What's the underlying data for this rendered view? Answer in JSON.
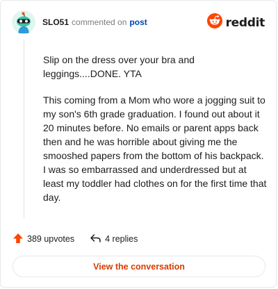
{
  "header": {
    "username": "SLO51",
    "commented_text": "commented on",
    "post_link": "post"
  },
  "brand": {
    "name": "reddit",
    "color": "#ff4500"
  },
  "comment": {
    "paragraphs": [
      "Slip on the dress over your bra and leggings....DONE. YTA",
      "This coming from a Mom who wore a jogging suit to my son's 6th grade graduation. I found out about it 20 minutes before. No emails or parent apps back then and he was horrible about giving me the smooshed papers from the bottom of his backpack. I was so embarrassed and underdressed but at least my toddler had clothes on for the first time that day."
    ]
  },
  "footer": {
    "upvotes": "389 upvotes",
    "replies": "4 replies",
    "upvote_icon": "upvote-arrow-icon",
    "reply_icon": "reply-arrow-icon",
    "upvote_color": "#ff4500"
  },
  "cta": {
    "label": "View the conversation",
    "color": "#d93a00"
  }
}
